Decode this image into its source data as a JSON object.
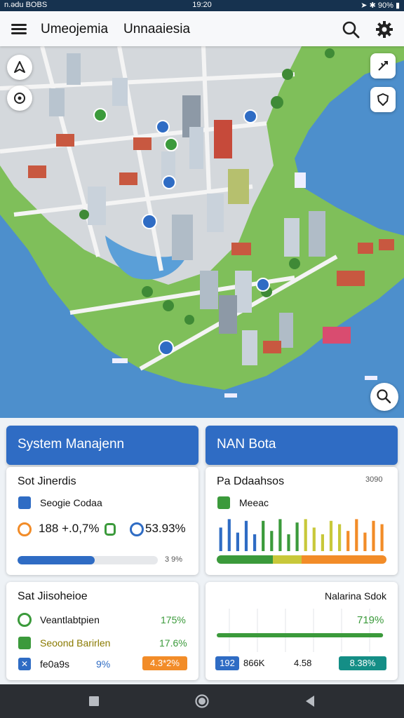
{
  "status": {
    "left": "n.ədu BOBS",
    "time": "19:20",
    "battery": "90%"
  },
  "appbar": {
    "title_primary": "Umeojemia",
    "title_secondary": "Unnaaiesia"
  },
  "icons": {
    "menu": "menu-icon",
    "search": "search-icon",
    "settings": "gear-icon",
    "map_navigate": "navigation-arrow-icon",
    "map_locate": "location-icon",
    "map_route": "route-icon",
    "map_shield": "shield-icon",
    "map_search": "search-icon"
  },
  "colors": {
    "primary": "#2f6cc4",
    "green": "#3b9a3b",
    "orange": "#f28c28",
    "teal": "#148e86",
    "navbar": "#2b2e33"
  },
  "panels": {
    "left_header": "System Manajenn",
    "right_header": "NAN Bota",
    "card1": {
      "title": "Sot Jinerdis",
      "item_label": "Seogie Codaa",
      "metric_a": "188 +.0,7%",
      "metric_b": "53.93%",
      "progress_value": 0.55,
      "progress_label": "3 9%"
    },
    "card2": {
      "title": "Pa Ddaahsos",
      "corner": "3090",
      "item_label": "Meeac",
      "bars": [
        0.7,
        0.95,
        0.55,
        0.9,
        0.5,
        0.9,
        0.6,
        0.95,
        0.5,
        0.85,
        0.95,
        0.7,
        0.5,
        0.9,
        0.8,
        0.6,
        0.95,
        0.55,
        0.9,
        0.8
      ],
      "segments": [
        0.33,
        0.17,
        0.5
      ]
    },
    "card3": {
      "title": "Sat Jiisoheioe",
      "rows": [
        {
          "label": "Veantlabtpien",
          "value": "175%"
        },
        {
          "label": "Seoond Barirlen",
          "value": "17.6%"
        },
        {
          "label": "fe0a9s",
          "value": "9%",
          "highlight": "4.3*2%"
        }
      ]
    },
    "card4": {
      "title": "Nalarina Sdok",
      "value": "719%",
      "line_value": 0.98,
      "footer": [
        "192",
        "866K",
        "4.58",
        "8.38%"
      ]
    }
  }
}
